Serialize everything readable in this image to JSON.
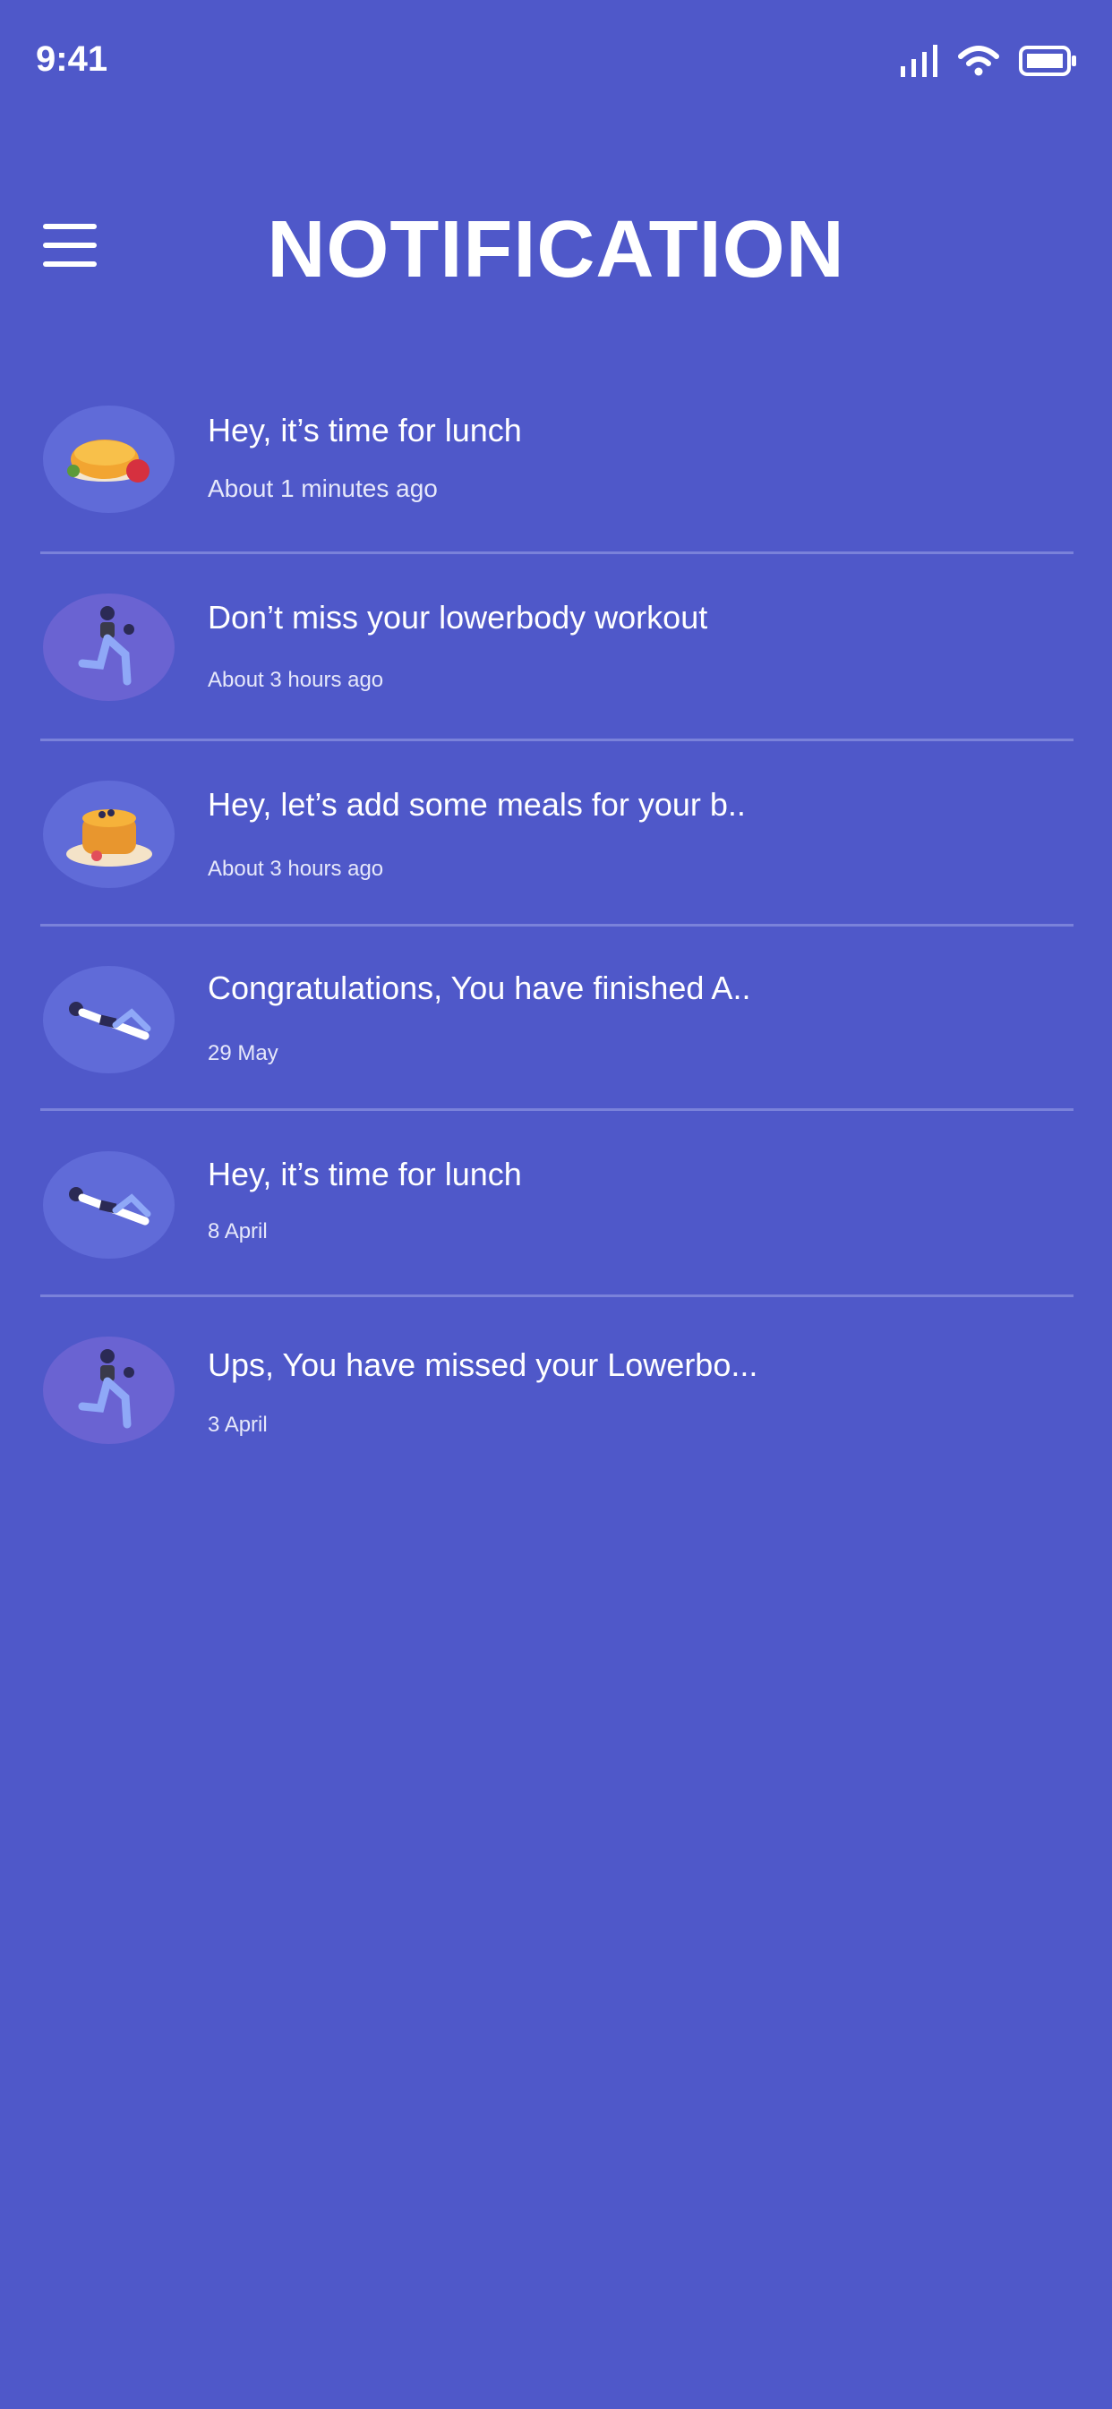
{
  "status_bar": {
    "time": "9:41",
    "icons": [
      "signal-icon",
      "wifi-icon",
      "battery-icon"
    ]
  },
  "header": {
    "title": "NOTIFICATION",
    "menu_icon": "hamburger-menu-icon"
  },
  "notifications": [
    {
      "title": "Hey, it’s time for lunch",
      "time": "About 1 minutes ago",
      "icon": "pie-food-icon"
    },
    {
      "title": "Don’t miss your lowerbody workout",
      "time": "About 3 hours ago",
      "icon": "workout-woman-icon"
    },
    {
      "title": "Hey, let’s add some meals for your b..",
      "time": "About 3 hours ago",
      "icon": "pancakes-icon"
    },
    {
      "title": "Congratulations, You have finished A..",
      "time": "29 May",
      "icon": "lying-exercise-icon"
    },
    {
      "title": "Hey, it’s time for lunch",
      "time": "8 April",
      "icon": "lying-exercise-icon"
    },
    {
      "title": "Ups, You have missed your Lowerbo...",
      "time": "3 April",
      "icon": "workout-woman-icon"
    }
  ],
  "colors": {
    "background": "#4F58C9",
    "avatar": "#606BD8",
    "divider": "#7A82DA"
  }
}
